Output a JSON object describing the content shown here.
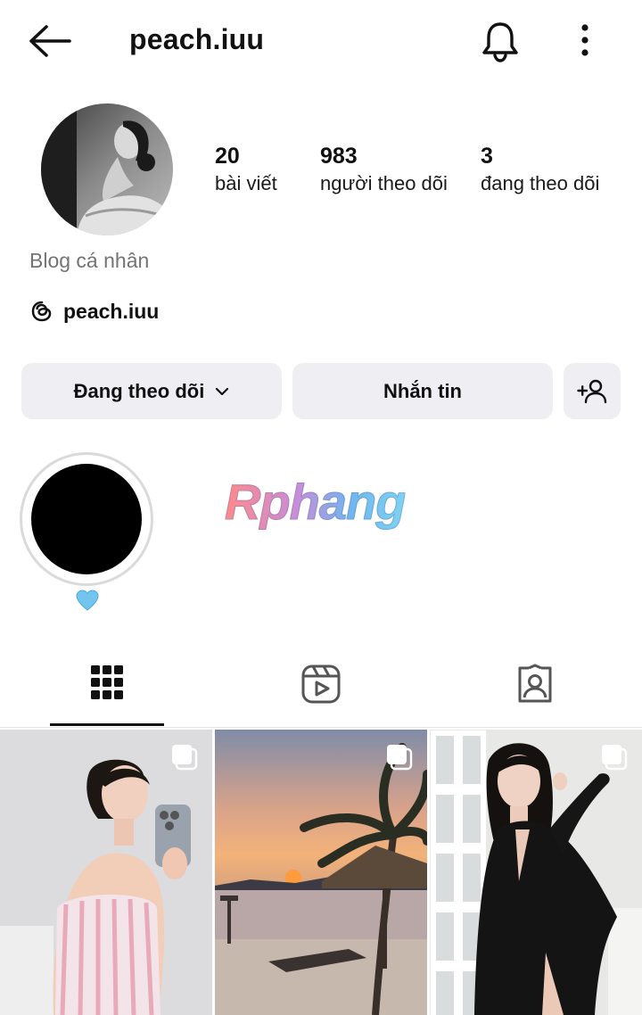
{
  "header": {
    "username": "peach.iuu",
    "back_icon": "arrow-left-icon",
    "notification_icon": "bell-icon",
    "more_icon": "more-vertical-icon"
  },
  "profile": {
    "stats": [
      {
        "value": "20",
        "label": "bài viết"
      },
      {
        "value": "983",
        "label": "người theo dõi"
      },
      {
        "value": "3",
        "label": "đang theo dõi"
      }
    ],
    "category": "Blog cá nhân",
    "threads_handle": "peach.iuu"
  },
  "actions": {
    "following_label": "Đang theo dõi",
    "message_label": "Nhắn tin"
  },
  "highlights": [
    {
      "label": "💙"
    }
  ],
  "watermark": "Rphang",
  "tabs": [
    {
      "icon": "grid-icon",
      "active": true
    },
    {
      "icon": "reels-icon",
      "active": false
    },
    {
      "icon": "tagged-icon",
      "active": false
    }
  ],
  "colors": {
    "button_bg": "#efeff3",
    "muted_text": "#737373",
    "text": "#111111"
  }
}
